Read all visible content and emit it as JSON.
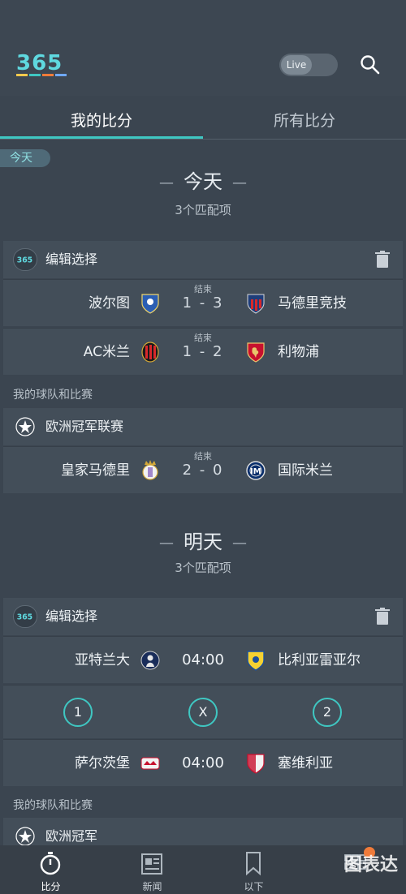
{
  "header": {
    "logo_text": "365",
    "live_label": "Live"
  },
  "tabs": [
    {
      "label": "我的比分",
      "active": true
    },
    {
      "label": "所有比分",
      "active": false
    }
  ],
  "today_pill": "今天",
  "today": {
    "heading": "今天",
    "sub": "3个匹配项",
    "card1": {
      "title": "编辑选择",
      "matches": [
        {
          "home": "波尔图",
          "away": "马德里竞技",
          "status": "结束",
          "score": "1 - 3"
        },
        {
          "home": "AC米兰",
          "away": "利物浦",
          "status": "结束",
          "score": "1 - 2"
        }
      ]
    },
    "section_label": "我的球队和比赛",
    "card2": {
      "title": "欧洲冠军联赛",
      "matches": [
        {
          "home": "皇家马德里",
          "away": "国际米兰",
          "status": "结束",
          "score": "2 - 0"
        }
      ]
    }
  },
  "tomorrow": {
    "heading": "明天",
    "sub": "3个匹配项",
    "card1": {
      "title": "编辑选择",
      "matches": [
        {
          "home": "亚特兰大",
          "away": "比利亚雷亚尔",
          "time": "04:00"
        },
        {
          "home": "萨尔茨堡",
          "away": "塞维利亚",
          "time": "04:00"
        }
      ],
      "odds": [
        "1",
        "X",
        "2"
      ]
    },
    "section_label": "我的球队和比赛",
    "card2": {
      "title": "欧洲冠军"
    }
  },
  "bottom_nav": [
    {
      "label": "比分",
      "icon": "stopwatch-icon"
    },
    {
      "label": "新闻",
      "icon": "newspaper-icon"
    },
    {
      "label": "以下",
      "icon": "bookmark-icon"
    },
    {
      "label": "",
      "icon": "grid-menu-icon"
    }
  ],
  "watermark": "图表达",
  "colors": {
    "accent": "#3fc7c2",
    "background": "#3b4550",
    "card": "#434e59",
    "badge": "#f07b3a"
  }
}
